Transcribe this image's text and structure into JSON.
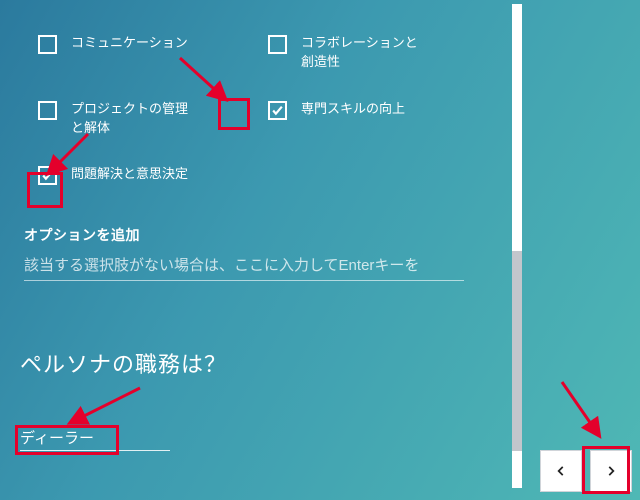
{
  "options": [
    {
      "label": "コミュニケーション",
      "checked": false
    },
    {
      "label": "コラボレーションと創造性",
      "checked": false
    },
    {
      "label": "プロジェクトの管理と解体",
      "checked": false
    },
    {
      "label": "専門スキルの向上",
      "checked": true
    },
    {
      "label": "問題解決と意思決定",
      "checked": true
    }
  ],
  "add_option": {
    "title": "オプションを追加",
    "placeholder": "該当する選択肢がない場合は、ここに入力してEnterキーを"
  },
  "question": "ペルソナの職務は？",
  "role_value": "ディーラー"
}
